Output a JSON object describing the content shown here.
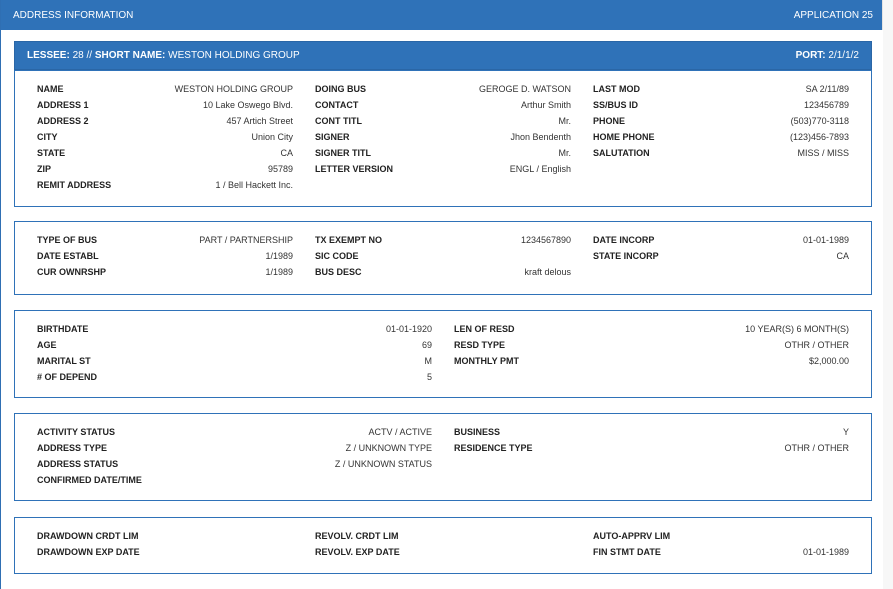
{
  "window": {
    "title": "ADDRESS INFORMATION",
    "application": "APPLICATION 25"
  },
  "lessee": {
    "lessee_label": "LESSEE:",
    "lessee_value": "28",
    "separator": "//",
    "short_name_label": "SHORT NAME:",
    "short_name_value": "WESTON HOLDING GROUP",
    "port_label": "PORT:",
    "port_value": "2/1/1/2"
  },
  "panel1": {
    "col1": [
      {
        "label": "NAME",
        "value": "WESTON HOLDING GROUP"
      },
      {
        "label": "ADDRESS 1",
        "value": "10 Lake Oswego Blvd."
      },
      {
        "label": "ADDRESS 2",
        "value": "457 Artich Street"
      },
      {
        "label": "CITY",
        "value": "Union City"
      },
      {
        "label": "STATE",
        "value": "CA"
      },
      {
        "label": "ZIP",
        "value": "95789"
      },
      {
        "label": "REMIT ADDRESS",
        "value": "1 / Bell Hackett Inc."
      }
    ],
    "col2": [
      {
        "label": "DOING BUS",
        "value": "GEROGE D. WATSON"
      },
      {
        "label": "CONTACT",
        "value": "Arthur Smith"
      },
      {
        "label": "CONT TITL",
        "value": "Mr."
      },
      {
        "label": "SIGNER",
        "value": "Jhon Bendenth"
      },
      {
        "label": "SIGNER TITL",
        "value": "Mr."
      },
      {
        "label": "LETTER VERSION",
        "value": "ENGL / English"
      }
    ],
    "col3": [
      {
        "label": "LAST MOD",
        "value": "SA 2/11/89"
      },
      {
        "label": "SS/BUS ID",
        "value": "123456789"
      },
      {
        "label": "PHONE",
        "value": "(503)770-3118"
      },
      {
        "label": "HOME PHONE",
        "value": "(123)456-7893"
      },
      {
        "label": "SALUTATION",
        "value": "MISS / MISS"
      }
    ]
  },
  "panel2": {
    "col1": [
      {
        "label": "TYPE OF BUS",
        "value": "PART / PARTNERSHIP"
      },
      {
        "label": "DATE ESTABL",
        "value": "1/1989"
      },
      {
        "label": "CUR OWNRSHP",
        "value": "1/1989"
      }
    ],
    "col2": [
      {
        "label": "TX EXEMPT NO",
        "value": "1234567890"
      },
      {
        "label": "SIC CODE",
        "value": ""
      },
      {
        "label": "BUS DESC",
        "value": "kraft delous"
      }
    ],
    "col3": [
      {
        "label": "DATE INCORP",
        "value": "01-01-1989"
      },
      {
        "label": "STATE INCORP",
        "value": "CA"
      }
    ]
  },
  "panel3": {
    "col1": [
      {
        "label": "BIRTHDATE",
        "value": "01-01-1920"
      },
      {
        "label": "AGE",
        "value": "69"
      },
      {
        "label": "MARITAL ST",
        "value": "M"
      },
      {
        "label": "# OF DEPEND",
        "value": "5"
      }
    ],
    "col2": [
      {
        "label": "LEN OF RESD",
        "value": "10 YEAR(S) 6 MONTH(S)"
      },
      {
        "label": "RESD TYPE",
        "value": "OTHR / OTHER"
      },
      {
        "label": "MONTHLY PMT",
        "value": "$2,000.00"
      }
    ]
  },
  "panel4": {
    "col1": [
      {
        "label": "ACTIVITY STATUS",
        "value": "ACTV / ACTIVE"
      },
      {
        "label": "ADDRESS TYPE",
        "value": "Z / UNKNOWN TYPE"
      },
      {
        "label": "ADDRESS STATUS",
        "value": "Z / UNKNOWN STATUS"
      },
      {
        "label": "CONFIRMED DATE/TIME",
        "value": ""
      }
    ],
    "col2": [
      {
        "label": "BUSINESS",
        "value": "Y"
      },
      {
        "label": "RESIDENCE TYPE",
        "value": "OTHR / OTHER"
      }
    ]
  },
  "panel5": {
    "col1": [
      {
        "label": "DRAWDOWN CRDT LIM",
        "value": ""
      },
      {
        "label": "DRAWDOWN EXP DATE",
        "value": ""
      }
    ],
    "col2": [
      {
        "label": "REVOLV. CRDT LIM",
        "value": ""
      },
      {
        "label": "REVOLV. EXP DATE",
        "value": ""
      }
    ],
    "col3": [
      {
        "label": "AUTO-APPRV LIM",
        "value": ""
      },
      {
        "label": "FIN STMT DATE",
        "value": "01-01-1989"
      }
    ]
  }
}
